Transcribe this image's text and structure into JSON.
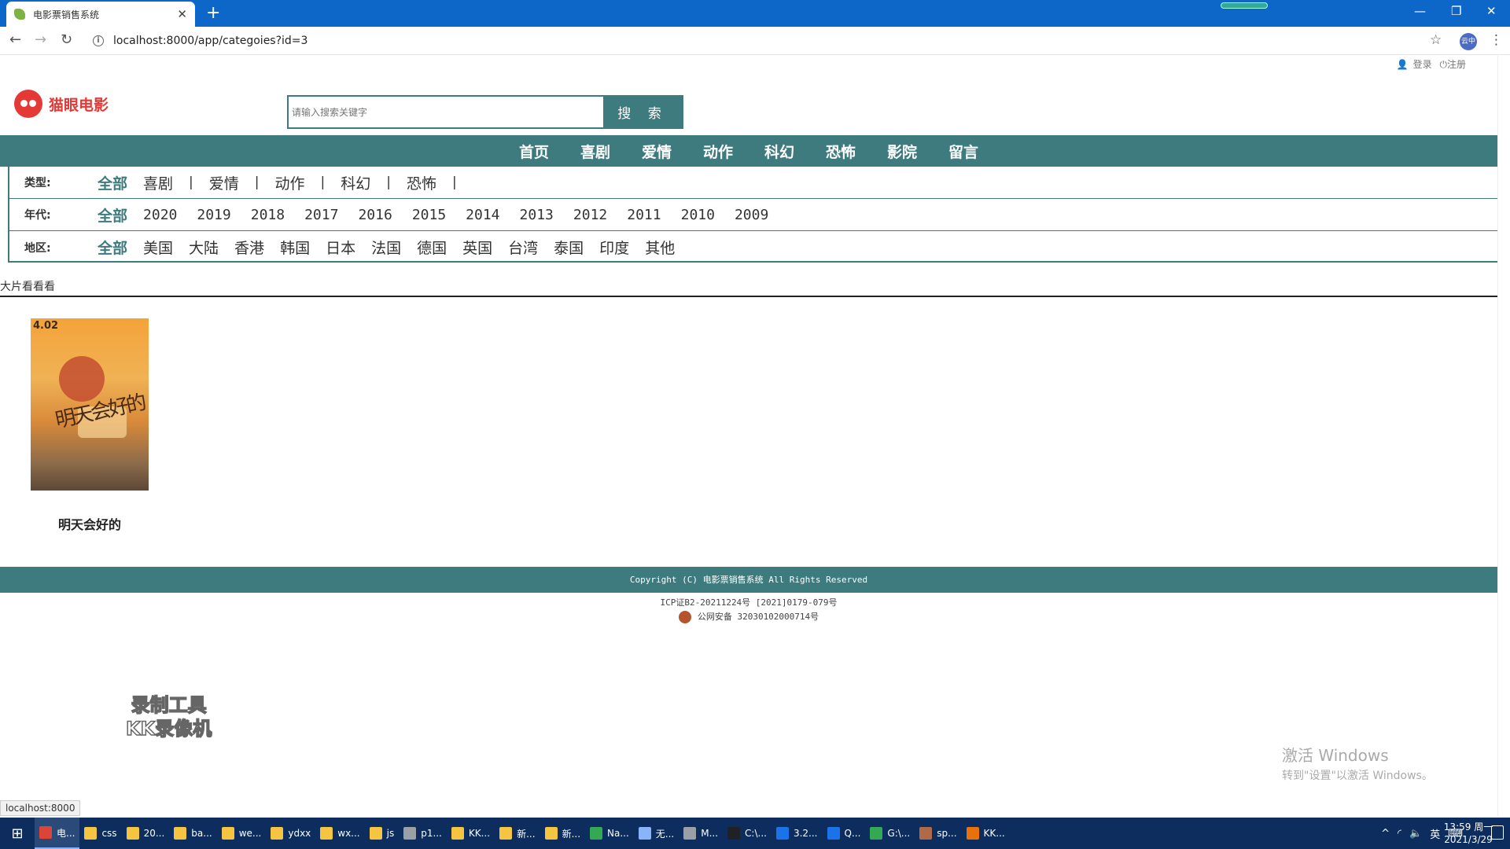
{
  "browser": {
    "tab_title": "电影票销售系统",
    "url": "localhost:8000/app/categoies?id=3",
    "status_url": "localhost:8000",
    "profile_label": "云中"
  },
  "header": {
    "login": "登录",
    "register": "注册",
    "logo_text": "猫眼电影",
    "search_placeholder": "请输入搜索关键字",
    "search_button": "搜 索"
  },
  "nav": [
    "首页",
    "喜剧",
    "爱情",
    "动作",
    "科幻",
    "恐怖",
    "影院",
    "留言"
  ],
  "filters": {
    "genre": {
      "label": "类型:",
      "all": "全部",
      "options": [
        "喜剧",
        "爱情",
        "动作",
        "科幻",
        "恐怖"
      ]
    },
    "year": {
      "label": "年代:",
      "all": "全部",
      "options": [
        "2020",
        "2019",
        "2018",
        "2017",
        "2016",
        "2015",
        "2014",
        "2013",
        "2012",
        "2011",
        "2010",
        "2009"
      ]
    },
    "region": {
      "label": "地区:",
      "all": "全部",
      "options": [
        "美国",
        "大陆",
        "香港",
        "韩国",
        "日本",
        "法国",
        "德国",
        "英国",
        "台湾",
        "泰国",
        "印度",
        "其他"
      ]
    }
  },
  "section_title": "大片看看看",
  "movies": [
    {
      "title": "明天会好的",
      "poster_date": "4.02",
      "poster_calligraphy": "明天会好的"
    }
  ],
  "footer": {
    "copyright": "Copyright (C) 电影票销售系统 All Rights Reserved",
    "icp": "ICP证B2-20211224号 [2021]0179-079号",
    "police": "公网安备 32030102000714号"
  },
  "overlays": {
    "recorder_line1": "录制工具",
    "recorder_line2": "KK录像机",
    "activate_title": "激活 Windows",
    "activate_sub": "转到\"设置\"以激活 Windows。"
  },
  "taskbar": {
    "items": [
      {
        "label": "电...",
        "color": "#db4437"
      },
      {
        "label": "css",
        "color": "#f5c542"
      },
      {
        "label": "20...",
        "color": "#f5c542"
      },
      {
        "label": "ba...",
        "color": "#f5c542"
      },
      {
        "label": "we...",
        "color": "#f5c542"
      },
      {
        "label": "ydxx",
        "color": "#f5c542"
      },
      {
        "label": "wx...",
        "color": "#f5c542"
      },
      {
        "label": "js",
        "color": "#f5c542"
      },
      {
        "label": "p1...",
        "color": "#9aa0a6"
      },
      {
        "label": "KK...",
        "color": "#f5c542"
      },
      {
        "label": "新...",
        "color": "#f5c542"
      },
      {
        "label": "新...",
        "color": "#f5c542"
      },
      {
        "label": "Na...",
        "color": "#34a853"
      },
      {
        "label": "无...",
        "color": "#8ab4f8"
      },
      {
        "label": "M...",
        "color": "#9aa0a6"
      },
      {
        "label": "C:\\...",
        "color": "#202124"
      },
      {
        "label": "3.2...",
        "color": "#1a73e8"
      },
      {
        "label": "Q...",
        "color": "#1a73e8"
      },
      {
        "label": "G:\\...",
        "color": "#34a853"
      },
      {
        "label": "sp...",
        "color": "#b06a4a"
      },
      {
        "label": "KK...",
        "color": "#e8710a"
      }
    ],
    "ime": "英",
    "time": "13:59 周一",
    "date": "2021/3/29"
  }
}
